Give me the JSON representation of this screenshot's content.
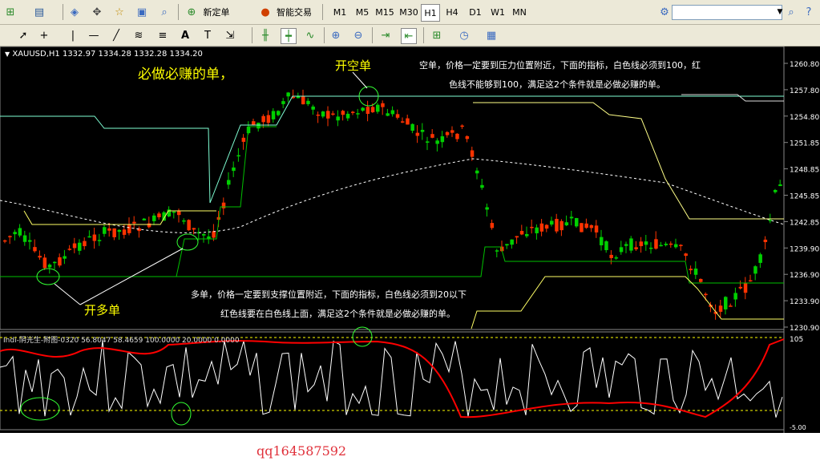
{
  "toolbar1": {
    "new_order_label": "新定单",
    "auto_trade_label": "智能交易",
    "timeframes": [
      "M1",
      "M5",
      "M15",
      "M30",
      "H1",
      "H4",
      "D1",
      "W1",
      "MN"
    ],
    "active_timeframe": "H1"
  },
  "chart": {
    "header": "XAUUSD,H1  1332.97 1334.28 1332.28 1334.20",
    "indicator_header": "Indi-阴光生-附图-0320 56.8047 58.4659 100.0000 20.0000 0.0000",
    "price_ticks": [
      "1260.80",
      "1257.80",
      "1254.80",
      "1251.85",
      "1248.85",
      "1245.85",
      "1242.85",
      "1239.90",
      "1236.90",
      "1233.90",
      "1230.90"
    ],
    "indicator_ticks": [
      "105",
      "-5.00"
    ],
    "title_annotation": "必做必赚的单，",
    "open_short_label": "开空单",
    "open_long_label": "开多单",
    "short_note_line1": "空单，价格一定要到压力位置附近，下面的指标，白色线必须到100，红",
    "short_note_line2": "色线不能够到100，满足这2个条件就是必做必赚的单。",
    "long_note_line1": "多单，价格一定要到支撑位置附近，下面的指标，白色线必须到20以下",
    "long_note_line2": "红色线要在白色线上面，满足这2个条件就是必做必赚的单。"
  },
  "footer": {
    "contact": "qq164587592"
  },
  "colors": {
    "bull": "#00d000",
    "bear": "#ff3300",
    "ma": "#ffffff",
    "resistance": "#7fffd4",
    "support": "#00c000",
    "channel": "#ffff66",
    "red_line": "#ff0000"
  }
}
